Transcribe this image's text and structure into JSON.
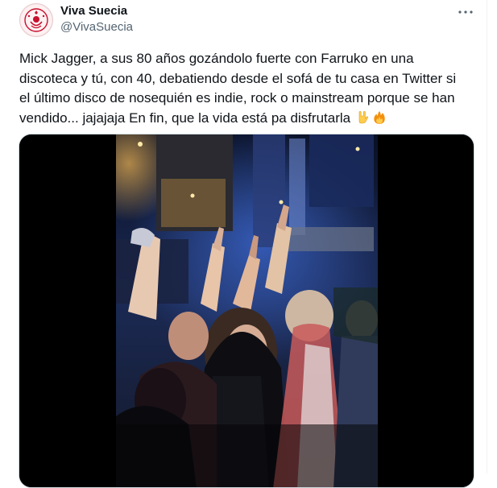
{
  "author": {
    "name": "Viva Suecia",
    "handle": "@VivaSuecia"
  },
  "tweet": {
    "lines": [
      "Mick Jagger, a sus 80 años gozándolo fuerte con Farruko en una",
      "discoteca y tú, con 40, debatiendo desde el sofá de tu casa en Twitter si",
      "el último disco de nosequién es indie, rock o mainstream porque se han",
      "vendido... jajajaja En fin, que la vida está pa disfrutarla"
    ],
    "emojis": [
      "rock-on-hand-icon",
      "fire-icon"
    ]
  },
  "media": {
    "type": "video",
    "scene": "concert-crowd-dancing"
  },
  "icons": {
    "avatar": "viva-suecia-logo-icon",
    "more": "more-options-icon"
  },
  "colors": {
    "text": "#0f1419",
    "secondary": "#536471",
    "border": "#cfd9de",
    "logo": "#c8102e"
  }
}
